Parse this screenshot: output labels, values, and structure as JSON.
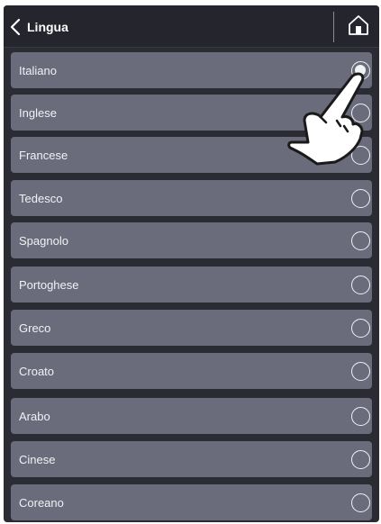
{
  "header": {
    "title": "Lingua",
    "back_icon": "chevron-left-icon",
    "home_icon": "home-icon"
  },
  "languages": [
    {
      "label": "Italiano",
      "selected": true
    },
    {
      "label": "Inglese",
      "selected": false
    },
    {
      "label": "Francese",
      "selected": false
    },
    {
      "label": "Tedesco",
      "selected": false
    },
    {
      "label": "Spagnolo",
      "selected": false
    },
    {
      "label": "Portoghese",
      "selected": false
    },
    {
      "label": "Greco",
      "selected": false
    },
    {
      "label": "Croato",
      "selected": false
    },
    {
      "label": "Arabo",
      "selected": false
    },
    {
      "label": "Cinese",
      "selected": false
    },
    {
      "label": "Coreano",
      "selected": false
    }
  ],
  "overlay": {
    "icon": "tap-hand-icon"
  },
  "colors": {
    "background": "#2a2b33",
    "row": "#6b6c7b",
    "text": "#f2f2f4"
  }
}
